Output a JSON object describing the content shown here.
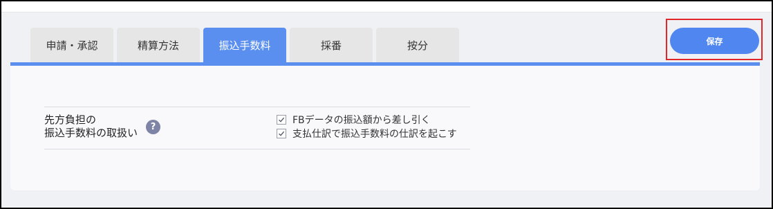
{
  "tabs": [
    {
      "label": "申請・承認",
      "active": false
    },
    {
      "label": "精算方法",
      "active": false
    },
    {
      "label": "振込手数料",
      "active": true
    },
    {
      "label": "採番",
      "active": false
    },
    {
      "label": "按分",
      "active": false
    }
  ],
  "toolbar": {
    "save_label": "保存"
  },
  "setting": {
    "label_line1": "先方負担の",
    "label_line2": "振込手数料の取扱い",
    "help_icon": "question-icon",
    "help_glyph": "?",
    "options": [
      {
        "label": "FBデータの振込額から差し引く",
        "checked": true
      },
      {
        "label": "支払仕訳で振込手数料の仕訳を起こす",
        "checked": true
      }
    ]
  },
  "colors": {
    "accent": "#5a8ff0",
    "save_button": "#4f86f0",
    "highlight": "#e1262a",
    "help_icon": "#7e84a6"
  }
}
